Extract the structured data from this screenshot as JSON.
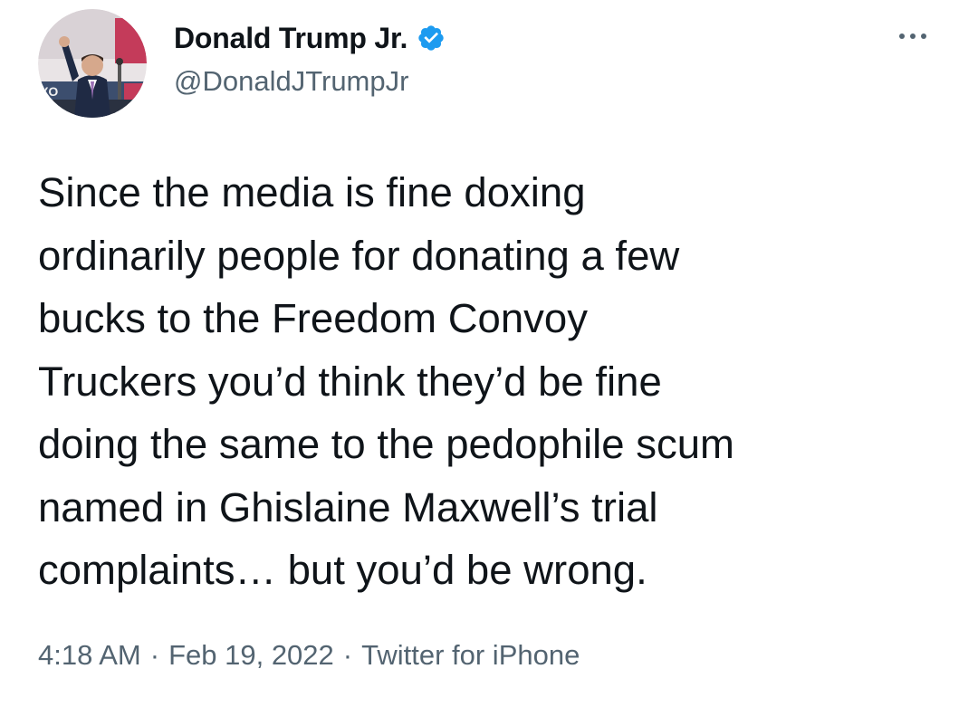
{
  "tweet": {
    "display_name": "Donald Trump Jr.",
    "handle": "@DonaldJTrumpJr",
    "verified": true,
    "avatar_icon": "profile-photo",
    "more_icon": "more-horizontal-icon",
    "text": "Since the media is fine doxing\nordinarily people for donating a few\nbucks to the Freedom Convoy\nTruckers you’d think they’d be fine\ndoing the same to the pedophile scum\nnamed in Ghislaine Maxwell’s trial\ncomplaints… but you’d be wrong.",
    "time": "4:18 AM",
    "date": "Feb 19, 2022",
    "source": "Twitter for iPhone",
    "separator": "·"
  },
  "colors": {
    "text_primary": "#0f1419",
    "text_secondary": "#536471",
    "verified_badge": "#1d9bf0"
  }
}
